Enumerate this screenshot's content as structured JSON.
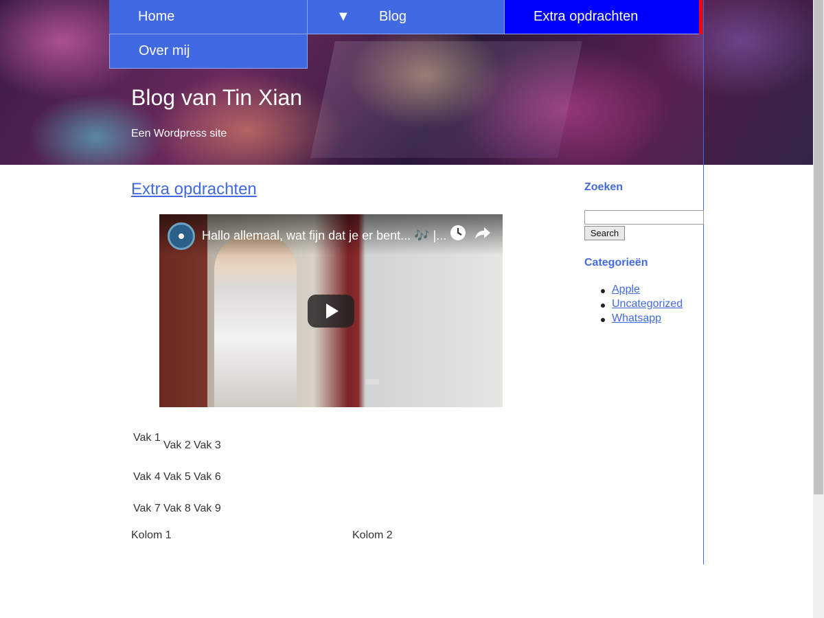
{
  "nav": {
    "home": "Home",
    "blog_arrow": "▼",
    "blog": "Blog",
    "extra": "Extra opdrachten",
    "over": "Over mij"
  },
  "site": {
    "title": "Blog van Tin Xian",
    "tagline": "Een Wordpress site"
  },
  "post": {
    "title": "Extra opdrachten",
    "video": {
      "title": "Hallo allemaal, wat fijn dat je er bent... 🎶 |..."
    },
    "grid": [
      "Vak 1",
      "Vak 2",
      "Vak 3",
      "Vak 4",
      "Vak 5",
      "Vak 6",
      "Vak 7",
      "Vak 8",
      "Vak 9"
    ],
    "columns": [
      "Kolom 1",
      "Kolom 2"
    ]
  },
  "sidebar": {
    "search_heading": "Zoeken",
    "search_value": "",
    "search_button": "Search",
    "categories_heading": "Categorieën",
    "categories": [
      "Apple",
      "Uncategorized",
      "Whatsapp"
    ]
  },
  "colors": {
    "nav": "#4169e1",
    "nav_active": "#0000ff",
    "active_edge": "#ff0000",
    "link": "#4169e1"
  }
}
